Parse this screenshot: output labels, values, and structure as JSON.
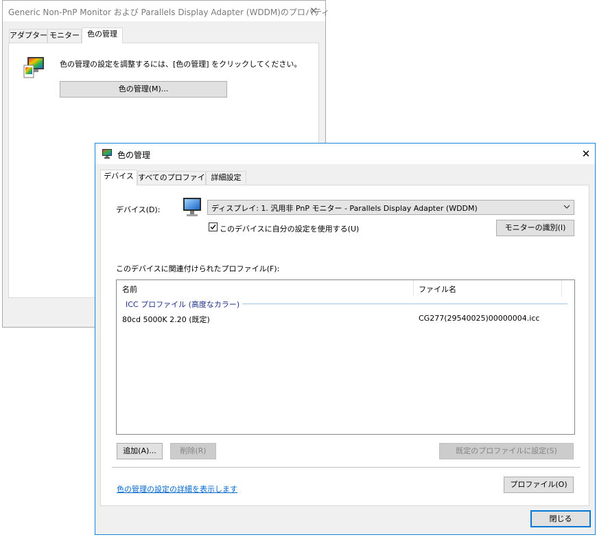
{
  "back_window": {
    "title": "Generic Non-PnP Monitor および Parallels Display Adapter (WDDM)のプロパティ",
    "tabs": [
      "アダプター",
      "モニター",
      "色の管理"
    ],
    "instruction": "色の管理の設定を調整するには、[色の管理] をクリックしてください。",
    "color_button": "色の管理(M)..."
  },
  "dialog": {
    "title": "色の管理",
    "tabs": [
      "デバイス",
      "すべてのプロファイル",
      "詳細設定"
    ],
    "device_label": "デバイス(D):",
    "device_value": "ディスプレイ: 1. 汎用非 PnP モニター - Parallels Display Adapter (WDDM)",
    "use_my_settings": "このデバイスに自分の設定を使用する(U)",
    "use_my_settings_checked": true,
    "identify_button": "モニターの識別(I)",
    "profiles_label": "このデバイスに関連付けられたプロファイル(F):",
    "table": {
      "headers": [
        "名前",
        "ファイル名"
      ],
      "group": "ICC プロファイル (高度なカラー)",
      "rows": [
        {
          "name": "80cd 5000K 2.20 (既定)",
          "file": "CG277(29540025)00000004.icc"
        }
      ]
    },
    "add_button": "追加(A)...",
    "remove_button": "削除(R)",
    "set_default_button": "既定のプロファイルに設定(S)",
    "link": "色の管理の設定の詳細を表示します",
    "profile_button": "プロファイル(O)",
    "close_button": "閉じる"
  }
}
